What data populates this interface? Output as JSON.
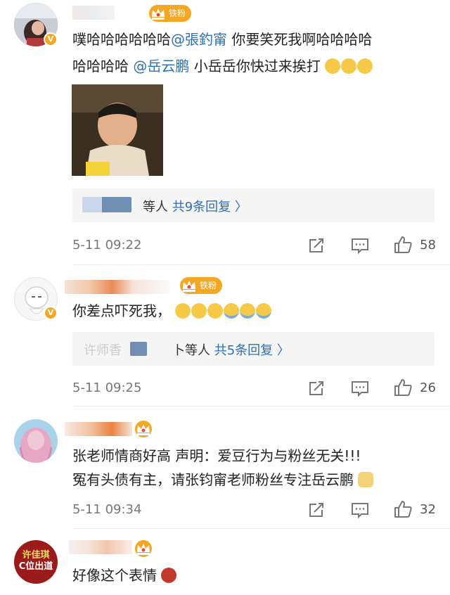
{
  "comments": [
    {
      "fan_badge": "铁粉",
      "text_line1_prefix": "噗哈哈哈哈哈哈",
      "mention1": "@張釣甯",
      "text_line1_suffix": " 你要笑死我啊哈哈哈哈",
      "text_line2_prefix": "哈哈哈哈 ",
      "mention2": "@岳云鹏",
      "text_line2_suffix": " 小岳岳你快过来挨打",
      "reply_suffix": "等人",
      "reply_count": "共9条回复 〉",
      "time": "5-11 09:22",
      "likes": "58"
    },
    {
      "fan_badge": "铁粉",
      "text": "你差点吓死我，",
      "reply_blur_text": "许师香",
      "reply_suffix": "卜等人",
      "reply_count": "共5条回复 〉",
      "time": "5-11 09:25",
      "likes": "26"
    },
    {
      "text_line1": "张老师情商好高 声明：爱豆行为与粉丝无关!!!",
      "text_line2": "冤有头债有主，请张钧甯老师粉丝专注岳云鹏",
      "time": "5-11 09:34",
      "likes": "32"
    },
    {
      "avatar_text_top": "许佳琪",
      "avatar_text_bottom": "C位出道",
      "text": "好像这个表情"
    }
  ],
  "icons": {
    "share": "share-icon",
    "comment": "comment-icon",
    "like": "thumbs-up-icon",
    "verified": "verified-badge-icon",
    "crown": "crown-fan-icon"
  },
  "colors": {
    "link": "#2f6fb6",
    "badge": "#f5a623",
    "muted": "#777777",
    "reply_bg": "#f5f5f5"
  }
}
